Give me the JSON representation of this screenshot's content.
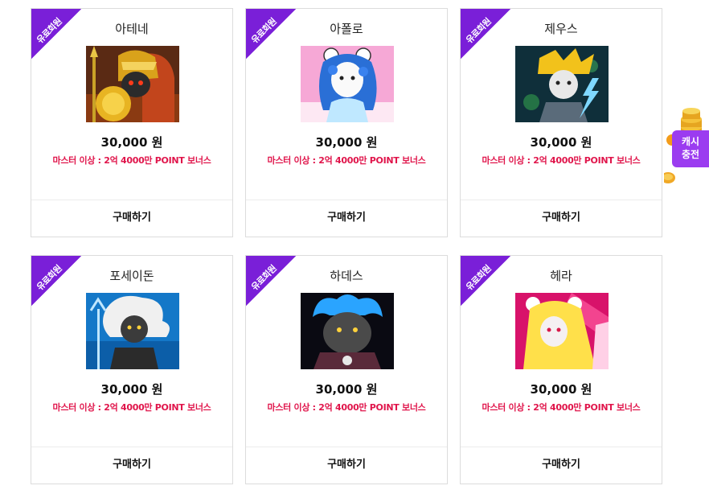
{
  "products": [
    {
      "ribbon": "유료회원",
      "name": "아테네",
      "price": "30,000 원",
      "bonus": "마스터 이상 : 2억 4000만 POINT 보너스",
      "buy_label": "구매하기",
      "thumb": "athena-avatar"
    },
    {
      "ribbon": "유료회원",
      "name": "아폴로",
      "price": "30,000 원",
      "bonus": "마스터 이상 : 2억 4000만 POINT 보너스",
      "buy_label": "구매하기",
      "thumb": "apollo-avatar"
    },
    {
      "ribbon": "유료회원",
      "name": "제우스",
      "price": "30,000 원",
      "bonus": "마스터 이상 : 2억 4000만 POINT 보너스",
      "buy_label": "구매하기",
      "thumb": "zeus-avatar"
    },
    {
      "ribbon": "유료회원",
      "name": "포세이돈",
      "price": "30,000 원",
      "bonus": "마스터 이상 : 2억 4000만 POINT 보너스",
      "buy_label": "구매하기",
      "thumb": "poseidon-avatar"
    },
    {
      "ribbon": "유료회원",
      "name": "하데스",
      "price": "30,000 원",
      "bonus": "마스터 이상 : 2억 4000만 POINT 보너스",
      "buy_label": "구매하기",
      "thumb": "hades-avatar"
    },
    {
      "ribbon": "유료회원",
      "name": "헤라",
      "price": "30,000 원",
      "bonus": "마스터 이상 : 2억 4000만 POINT 보너스",
      "buy_label": "구매하기",
      "thumb": "hera-avatar"
    }
  ],
  "cash_charge": {
    "line1": "캐시",
    "line2": "충전",
    "icon": "gold-coins-icon"
  },
  "colors": {
    "ribbon": "#7a1fd8",
    "bonus_text": "#e0154b",
    "cash_button": "#9b3cf0"
  }
}
